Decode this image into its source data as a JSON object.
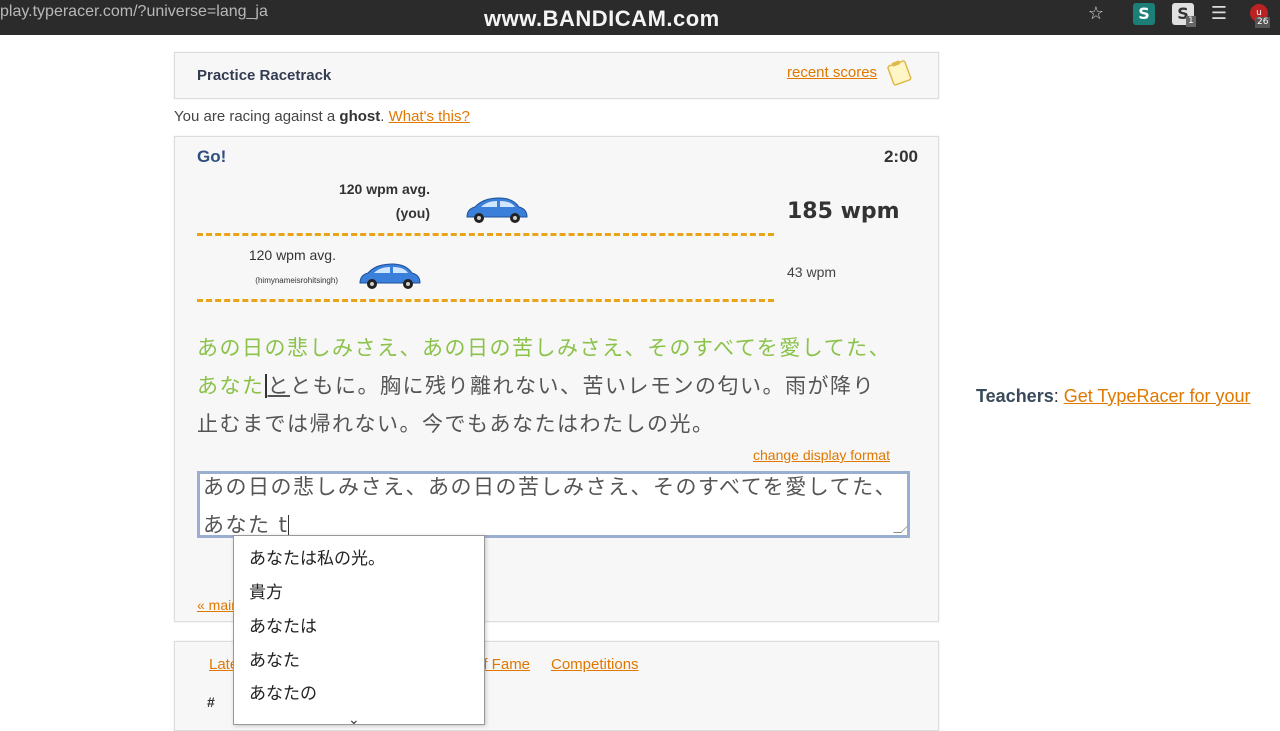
{
  "browser": {
    "url": "play.typeracer.com/?universe=lang_ja",
    "watermark": "www.BANDICAM.com",
    "ext_badge": "1",
    "ext_up_badge": "26",
    "icons": [
      "star-icon",
      "s-extension-icon",
      "s-extension-icon",
      "menu-icon",
      "ublock-icon"
    ]
  },
  "header": {
    "title": "Practice Racetrack",
    "recent_scores": "recent scores"
  },
  "ghost_notice": {
    "prefix": "You are racing against a",
    "bold": "ghost",
    "suffix": ".",
    "link": "What's this?"
  },
  "race": {
    "status": "Go!",
    "timer": "2:00",
    "you": {
      "avg": "120 wpm avg.",
      "tag": "(you)",
      "wpm": "185 wpm",
      "progress": 0.52
    },
    "ghost": {
      "avg": "120 wpm avg.",
      "name": "(himynameisrohitsingh)",
      "wpm": "43 wpm",
      "progress": 0.31
    },
    "passage": {
      "typed": "あの日の悲しみさえ、あの日の苦しみさえ、そのすべてを愛してた、あなた",
      "current": "と",
      "remaining": "ともに。胸に残り離れない、苦いレモンの匂い。雨が降り止むまでは帰れない。今でもあなたはわたしの光。"
    },
    "change_display_format": "change display format",
    "input": {
      "committed": "あの日の悲しみさえ、あの日の苦しみさえ、そのすべてを愛してた、",
      "composing": "あなた t"
    },
    "main_menu": "« main menu"
  },
  "teachers": {
    "label": "Teachers",
    "sep": ": ",
    "link": "Get TypeRacer for your"
  },
  "bottom_tabs": [
    "Latest",
    "Hall of Fame",
    "Competitions"
  ],
  "bottom_table": {
    "col_hash": "#"
  },
  "ime_candidates": [
    "あなたは私の光。",
    "貴方",
    "あなたは",
    "あなた",
    "あなたの"
  ],
  "colors": {
    "accent_link": "#e07800",
    "typed_text": "#8bc34a",
    "lane_dashes": "#e8a317",
    "car_blue": "#3a7fd9"
  }
}
